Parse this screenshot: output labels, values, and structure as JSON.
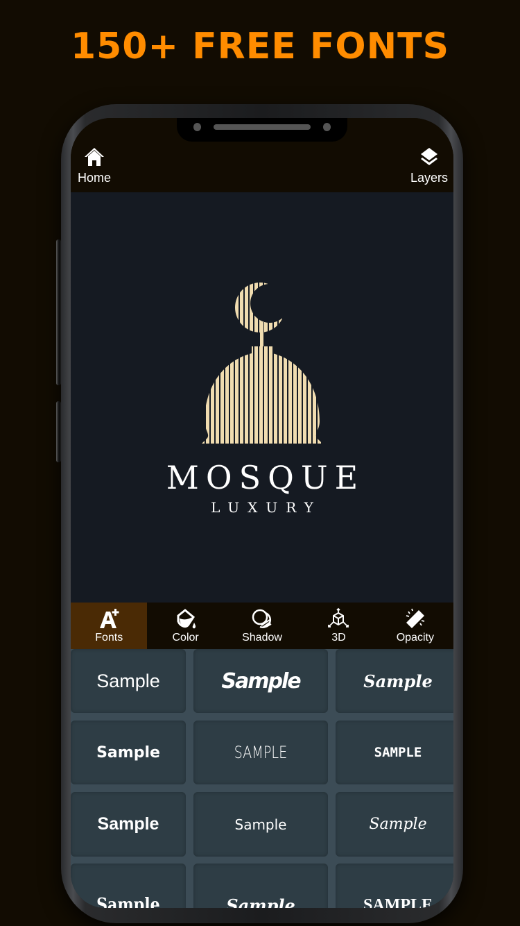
{
  "promo": {
    "title": "150+ FREE FONTS"
  },
  "colors": {
    "accent": "#ff8c00",
    "active_tab_bg": "#4a2a05",
    "canvas_bg": "#151a22",
    "logo_gold": "#f0dcb0",
    "cell_bg": "#2e3d45"
  },
  "topbar": {
    "home": {
      "label": "Home",
      "icon": "home-icon"
    },
    "layers": {
      "label": "Layers",
      "icon": "layers-icon"
    }
  },
  "canvas": {
    "logo": {
      "icon": "mosque-dome-crescent-icon",
      "title": "MOSQUE",
      "subtitle": "LUXURY"
    }
  },
  "toolbar": {
    "items": [
      {
        "label": "Fonts",
        "icon": "font-add-icon",
        "active": true
      },
      {
        "label": "Color",
        "icon": "paint-bucket-icon",
        "active": false
      },
      {
        "label": "Shadow",
        "icon": "shadow-icon",
        "active": false
      },
      {
        "label": "3D",
        "icon": "cube-3d-icon",
        "active": false
      },
      {
        "label": "Opacity",
        "icon": "opacity-icon",
        "active": false
      }
    ]
  },
  "fonts": {
    "samples": [
      "Sample",
      "Sample",
      "Sample",
      "Sample",
      "SAMPLE",
      "SAMPLE",
      "Sample",
      "Sample",
      "Sample",
      "Sample",
      "Sample",
      "SAMPLE"
    ]
  }
}
